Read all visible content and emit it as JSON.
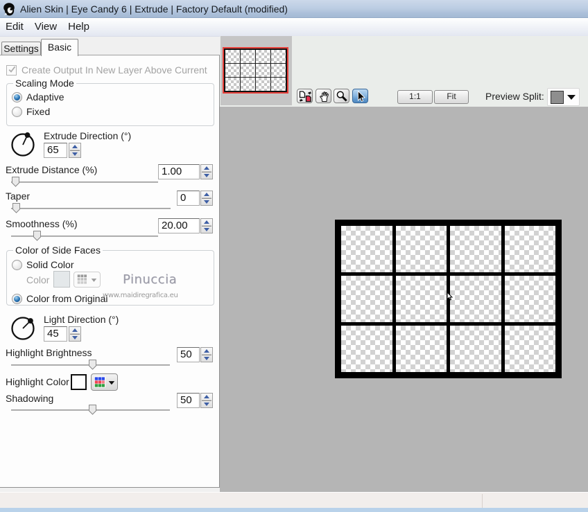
{
  "titlebar": {
    "title": "Alien Skin | Eye Candy 6 | Extrude | Factory Default (modified)",
    "icon": "alien-skin-logo"
  },
  "menu": {
    "items": [
      "Edit",
      "View",
      "Help"
    ]
  },
  "tabs": {
    "settings": "Settings",
    "basic": "Basic",
    "active": "Basic"
  },
  "panel": {
    "create_output_label": "Create Output In New Layer Above Current",
    "create_output_checked": true,
    "scaling_mode": {
      "legend": "Scaling Mode",
      "adaptive": "Adaptive",
      "fixed": "Fixed",
      "selected": "Adaptive"
    },
    "extrude_direction": {
      "label": "Extrude Direction (°)",
      "value": "65",
      "angle_deg": 65
    },
    "extrude_distance": {
      "label": "Extrude Distance (%)",
      "value": "1.00",
      "slider_pct": 3
    },
    "taper": {
      "label": "Taper",
      "value": "0",
      "slider_pct": 3
    },
    "smoothness": {
      "label": "Smoothness (%)",
      "value": "20.00",
      "slider_pct": 17.5
    },
    "color_of_side_faces": {
      "legend": "Color of Side Faces",
      "solid_color": "Solid Color",
      "color_label": "Color",
      "color_from_original": "Color from Original",
      "selected": "Color from Original"
    },
    "light_direction": {
      "label": "Light Direction (°)",
      "value": "45",
      "angle_deg": 45
    },
    "highlight_brightness": {
      "label": "Highlight Brightness",
      "value": "50",
      "slider_pct": 51
    },
    "highlight_color": {
      "label": "Highlight Color",
      "swatch_color": "#ffffff"
    },
    "shadowing": {
      "label": "Shadowing",
      "value": "50",
      "slider_pct": 51
    }
  },
  "watermark": {
    "line1": "Pinuccia",
    "line2": "www.maidiregrafica.eu"
  },
  "toolbar": {
    "tools": [
      "toggle-original",
      "hand",
      "zoom",
      "arrow"
    ],
    "active_tool": "arrow",
    "zoom_100": "1:1",
    "fit": "Fit",
    "preview_split_label": "Preview Split:",
    "preview_split_swatch": "#8e8e8e"
  },
  "preview": {
    "grid_columns": 4,
    "grid_rows": 3
  },
  "colors": {
    "titlebar_bg": "#b6c7dd",
    "preview_bg": "#b5b5b5",
    "navigator_border": "#e8403a",
    "active_tool_bg": "#5999d2",
    "spinner_arrow": "#3e5fa5"
  }
}
